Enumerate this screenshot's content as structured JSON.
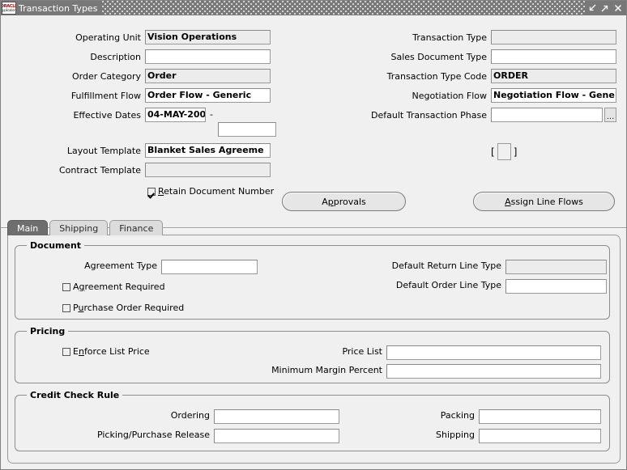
{
  "window": {
    "title": "Transaction Types",
    "icon": "oracle-logo-icon",
    "minimize_label": "↙",
    "maximize_label": "↗",
    "close_label": "✕"
  },
  "header_form": {
    "left_fields": [
      {
        "label": "Operating Unit",
        "value": "Vision Operations",
        "readonly": true
      },
      {
        "label": "Description",
        "value": "",
        "readonly": false
      },
      {
        "label": "Order Category",
        "value": "Order",
        "readonly": true
      },
      {
        "label": "Fulfillment Flow",
        "value": "Order Flow - Generic",
        "readonly": false
      },
      {
        "label": "Effective Dates",
        "value": "04-MAY-200",
        "readonly": false
      },
      {
        "label": "Layout Template",
        "value": "Blanket Sales Agreeme",
        "readonly": false
      },
      {
        "label": "Contract Template",
        "value": "",
        "readonly": true
      }
    ],
    "effective_dates_separator": "-",
    "effective_dates_to": "",
    "right_fields": [
      {
        "label": "Transaction Type",
        "value": "",
        "readonly": true
      },
      {
        "label": "Sales Document Type",
        "value": "",
        "readonly": false
      },
      {
        "label": "Transaction Type Code",
        "value": "ORDER",
        "readonly": true
      },
      {
        "label": "Negotiation Flow",
        "value": "Negotiation Flow - Gene",
        "readonly": false
      },
      {
        "label": "Default Transaction Phase",
        "value": "",
        "readonly": false,
        "lov": "..."
      }
    ],
    "flexfield": {
      "open_bracket": "[",
      "close_bracket": "]",
      "value": ""
    },
    "retain_checkbox": {
      "label_pre": "",
      "label_mnemonic": "R",
      "label_post": "etain Document Number",
      "checked": true
    },
    "buttons": [
      {
        "pre": "A",
        "mnemonic": "p",
        "post": "provals"
      },
      {
        "pre": "",
        "mnemonic": "A",
        "post": "ssign Line  Flows"
      }
    ]
  },
  "tabs": [
    {
      "label": "Main",
      "active": true
    },
    {
      "label": "Shipping",
      "active": false
    },
    {
      "label": "Finance",
      "active": false
    }
  ],
  "main_tab": {
    "document_group": {
      "title": "Document",
      "agreement_type": {
        "label": "Agreement Type",
        "value": "",
        "readonly": false
      },
      "default_return_line_type": {
        "label": "Default Return Line Type",
        "value": "",
        "readonly": true
      },
      "default_order_line_type": {
        "label": "Default Order Line Type",
        "value": "",
        "readonly": false
      },
      "checkboxes": [
        {
          "pre": "A",
          "mnemonic": "g",
          "post": "reement Required",
          "checked": false
        },
        {
          "pre": "P",
          "mnemonic": "u",
          "post": "rchase Order Required",
          "checked": false
        }
      ]
    },
    "pricing_group": {
      "title": "Pricing",
      "enforce_list_price": {
        "pre": "E",
        "mnemonic": "n",
        "post": "force List Price",
        "checked": false
      },
      "price_list": {
        "label": "Price List",
        "value": "",
        "readonly": false
      },
      "minimum_margin": {
        "label": "Minimum Margin Percent",
        "value": "",
        "readonly": false
      }
    },
    "credit_check_group": {
      "title": "Credit Check Rule",
      "ordering": {
        "label": "Ordering",
        "value": "",
        "readonly": false
      },
      "picking_release": {
        "label": "Picking/Purchase Release",
        "value": "",
        "readonly": false
      },
      "packing": {
        "label": "Packing",
        "value": "",
        "readonly": false
      },
      "shipping": {
        "label": "Shipping",
        "value": "",
        "readonly": false
      }
    }
  }
}
